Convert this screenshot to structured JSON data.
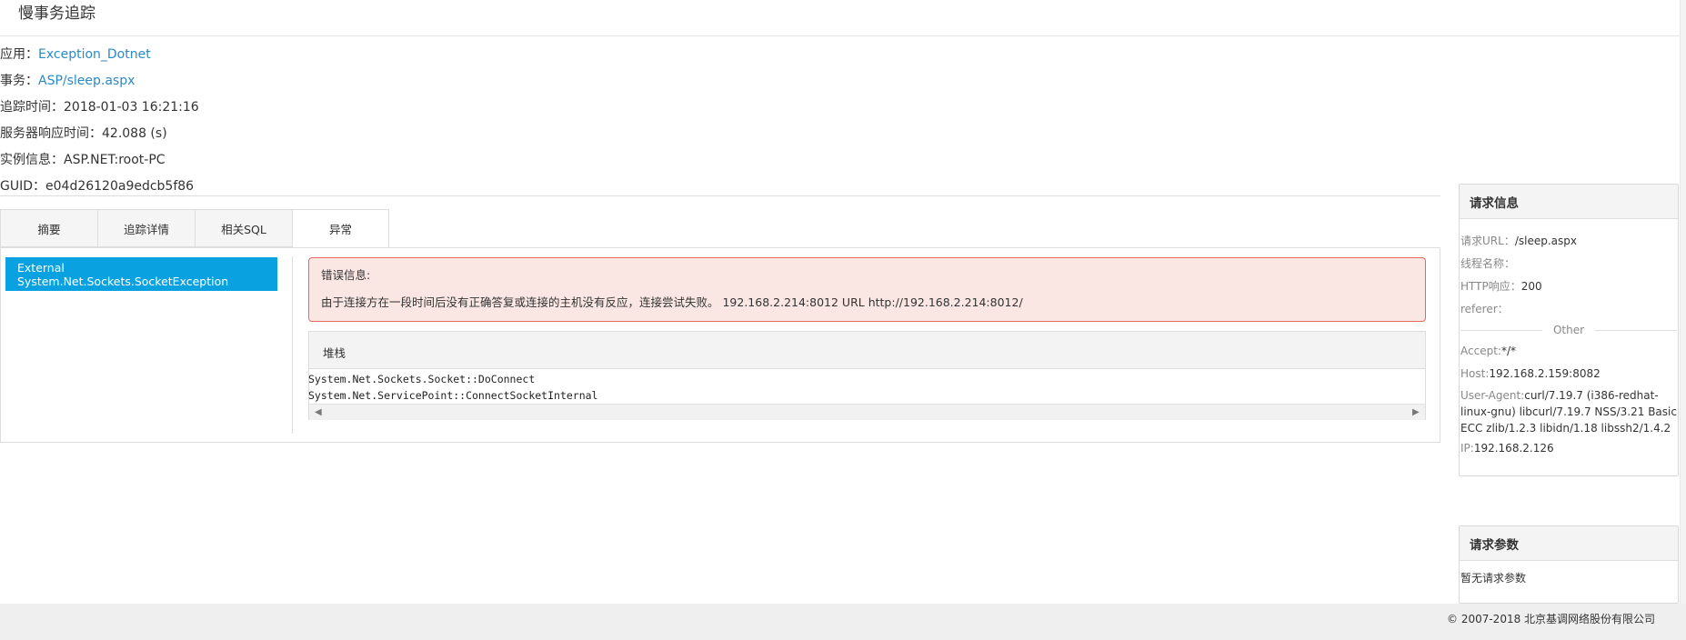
{
  "page_title": "慢事务追踪",
  "info": {
    "app_label": "应用：",
    "app_value": "Exception_Dotnet",
    "txn_label": "事务：",
    "txn_value": "ASP/sleep.aspx",
    "trace_time_label": "追踪时间：",
    "trace_time_value": "2018-01-03 16:21:16",
    "resp_time_label": "服务器响应时间：",
    "resp_time_value": "42.088 (s)",
    "instance_label": "实例信息：",
    "instance_value": "ASP.NET:root-PC",
    "guid_label": "GUID：",
    "guid_value": "e04d26120a9edcb5f86"
  },
  "tabs": [
    {
      "label": "摘要"
    },
    {
      "label": "追踪详情"
    },
    {
      "label": "相关SQL"
    },
    {
      "label": "异常",
      "active": true
    }
  ],
  "exceptions": [
    "External System.Net.Sockets.SocketException"
  ],
  "error": {
    "title": "错误信息:",
    "message": "由于连接方在一段时间后没有正确答复或连接的主机没有反应，连接尝试失败。 192.168.2.214:8012 URL http://192.168.2.214:8012/"
  },
  "stack": {
    "title": "堆栈",
    "lines": [
      "System.Net.Sockets.Socket::DoConnect",
      "System.Net.ServicePoint::ConnectSocketInternal"
    ]
  },
  "request_info": {
    "title": "请求信息",
    "url_label": "请求URL：",
    "url_value": "/sleep.aspx",
    "thread_label": "线程名称：",
    "thread_value": "",
    "http_label": "HTTP响应：",
    "http_value": "200",
    "referer_label": "referer：",
    "referer_value": "",
    "other_label": "Other",
    "accept_label": "Accept:",
    "accept_value": "*/*",
    "host_label": "Host:",
    "host_value": "192.168.2.159:8082",
    "ua_label": "User-Agent:",
    "ua_value": "curl/7.19.7 (i386-redhat-linux-gnu) libcurl/7.19.7 NSS/3.21 Basic ECC zlib/1.2.3 libidn/1.18 libssh2/1.4.2",
    "ip_label": "IP:",
    "ip_value": "192.168.2.126"
  },
  "request_params": {
    "title": "请求参数",
    "empty_text": "暂无请求参数"
  },
  "footer": "© 2007-2018  北京基调网络股份有限公司",
  "colors": {
    "accent_blue": "#0aa1e0",
    "link_blue": "#2a8ac8",
    "error_bg": "#fae6e3",
    "error_border": "#e46a5e"
  }
}
